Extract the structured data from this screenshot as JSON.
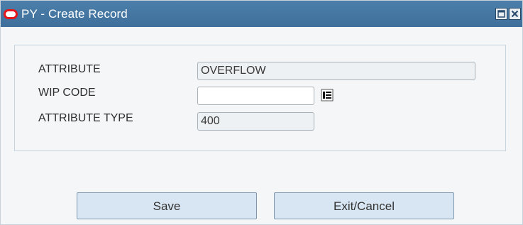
{
  "window": {
    "title": "PY - Create Record",
    "logo_icon": "oracle-logo-icon",
    "controls": [
      "restore-icon",
      "close-icon"
    ]
  },
  "form": {
    "attribute": {
      "label": "ATTRIBUTE",
      "value": "OVERFLOW"
    },
    "wip_code": {
      "label": "WIP CODE",
      "value": "",
      "lov_icon": "list-of-values-icon"
    },
    "attribute_type": {
      "label": "ATTRIBUTE TYPE",
      "value": "400"
    }
  },
  "buttons": {
    "save_label": "Save",
    "exit_label": "Exit/Cancel"
  },
  "colors": {
    "titlebar": "#4479a6",
    "button_fill": "#d8e6f3",
    "oracle_red": "#e3141a"
  }
}
